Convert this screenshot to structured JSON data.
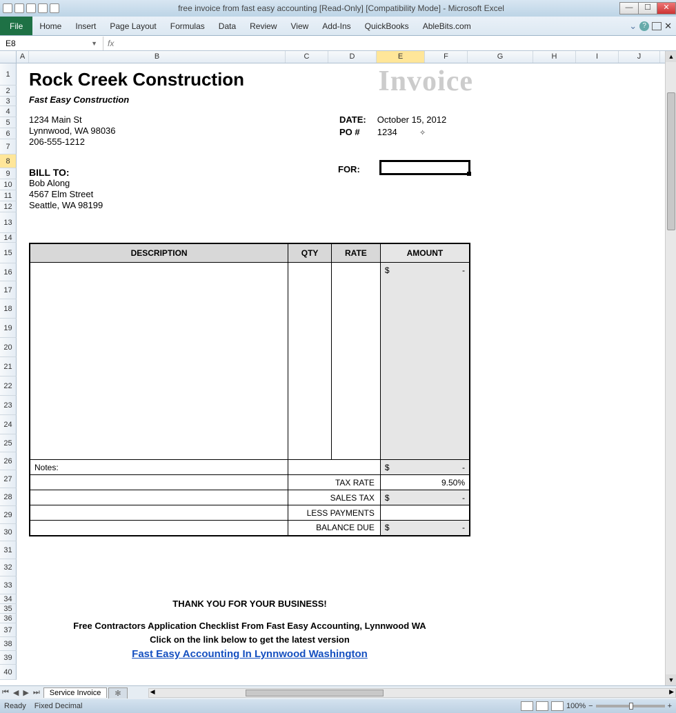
{
  "titlebar": {
    "text": "free invoice from fast easy accounting  [Read-Only]  [Compatibility Mode]  -  Microsoft Excel"
  },
  "ribbon": {
    "file": "File",
    "tabs": [
      "Home",
      "Insert",
      "Page Layout",
      "Formulas",
      "Data",
      "Review",
      "View",
      "Add-Ins",
      "QuickBooks",
      "AbleBits.com"
    ]
  },
  "namebox": "E8",
  "fx": "fx",
  "columns": [
    "A",
    "B",
    "C",
    "D",
    "E",
    "F",
    "G",
    "H",
    "I",
    "J"
  ],
  "rows": [
    "1",
    "2",
    "3",
    "4",
    "5",
    "6",
    "7",
    "8",
    "9",
    "10",
    "11",
    "12",
    "13",
    "14",
    "15",
    "16",
    "17",
    "18",
    "19",
    "20",
    "21",
    "22",
    "23",
    "24",
    "25",
    "26",
    "27",
    "28",
    "29",
    "30",
    "31",
    "32",
    "33",
    "34",
    "35",
    "36",
    "37",
    "38",
    "39",
    "40"
  ],
  "selectedRow": "8",
  "selectedCol": "E",
  "invoice": {
    "company": "Rock Creek Construction",
    "word": "Invoice",
    "tagline": "Fast Easy Construction",
    "addr1": "1234 Main St",
    "addr2": "Lynnwood, WA 98036",
    "phone": "206-555-1212",
    "dateLabel": "DATE:",
    "dateVal": "October 15, 2012",
    "poLabel": "PO #",
    "poVal": "1234",
    "billLabel": "BILL TO:",
    "bill1": "Bob Along",
    "bill2": "4567 Elm Street",
    "bill3": "Seattle, WA 98199",
    "forLabel": "FOR:",
    "table": {
      "h_desc": "DESCRIPTION",
      "h_qty": "QTY",
      "h_rate": "RATE",
      "h_amt": "AMOUNT",
      "notes": "Notes:",
      "taxRateLab": "TAX RATE",
      "taxRateVal": "9.50%",
      "salesTaxLab": "SALES TAX",
      "lessPayLab": "LESS PAYMENTS",
      "balanceLab": "BALANCE DUE",
      "dash": "-",
      "dollar": "$"
    },
    "thanks": "THANK YOU FOR YOUR BUSINESS!",
    "promo": "Free Contractors Application Checklist From Fast Easy Accounting, Lynnwood WA",
    "promo2": "Click on the link below to get the latest version",
    "link": "Fast Easy Accounting In Lynnwood Washington"
  },
  "sheetTabs": {
    "active": "Service Invoice",
    "other": "Fixed Decimal"
  },
  "status": {
    "ready": "Ready",
    "fixed": "Fixed Decimal",
    "zoom": "100%",
    "minus": "−",
    "plus": "+"
  }
}
